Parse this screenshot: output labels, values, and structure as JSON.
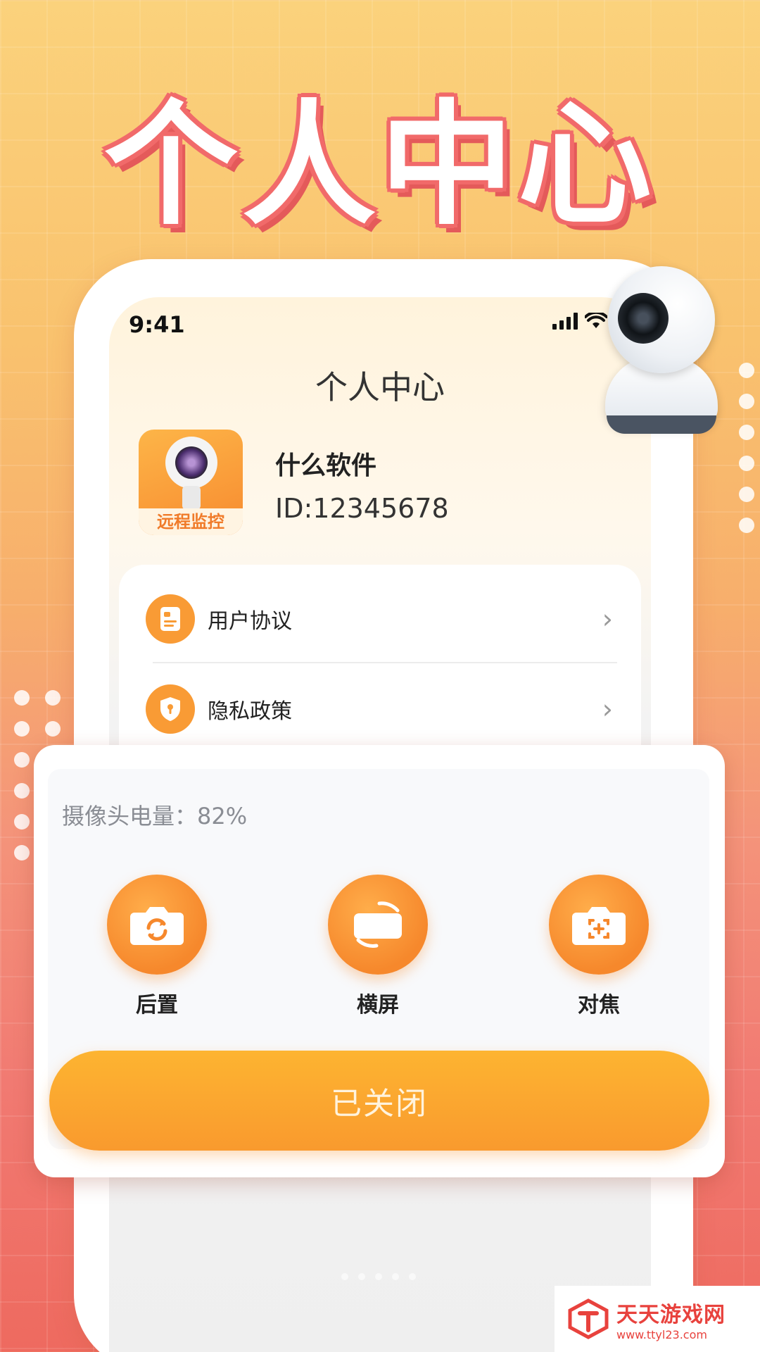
{
  "banner": {
    "headline": "个人中心"
  },
  "status_bar": {
    "time": "9:41"
  },
  "screen": {
    "title": "个人中心",
    "profile": {
      "avatar_tag": "远程监控",
      "name": "什么软件",
      "id": "ID:12345678"
    },
    "menu": [
      {
        "label": "用户协议",
        "icon": "document-icon"
      },
      {
        "label": "隐私政策",
        "icon": "shield-lock-icon"
      }
    ]
  },
  "control_panel": {
    "battery_text": "摄像头电量：82%",
    "actions": [
      {
        "label": "后置",
        "icon": "camera-switch-icon"
      },
      {
        "label": "横屏",
        "icon": "rotate-screen-icon"
      },
      {
        "label": "对焦",
        "icon": "camera-focus-icon"
      }
    ],
    "main_button": "已关闭"
  },
  "watermark": {
    "title": "天天游戏网",
    "url": "www.ttyl23.com"
  },
  "colors": {
    "accent_orange": "#f99b35",
    "headline_outline": "#f16a6a",
    "watermark_red": "#e8423d"
  }
}
